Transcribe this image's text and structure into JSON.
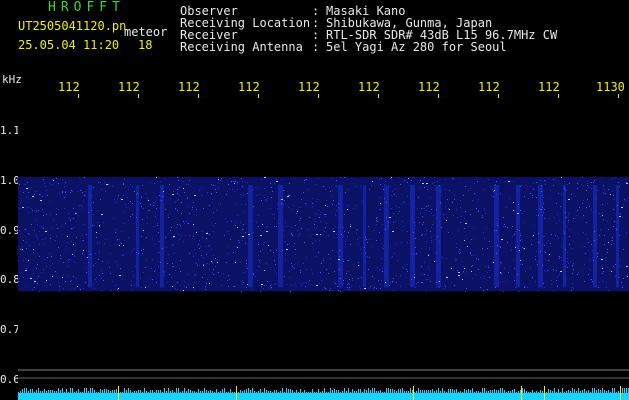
{
  "header": {
    "title": "HROFFT",
    "filename": "UT2505041120.pn",
    "filename_suffix": "meteor",
    "timestamp": "25.05.04 11:20",
    "count": "18"
  },
  "meta": [
    {
      "label": "Observer",
      "value": "Masaki Kano"
    },
    {
      "label": "Receiving Location",
      "value": "Shibukawa, Gunma, Japan"
    },
    {
      "label": "Receiver",
      "value": "RTL-SDR SDR# 43dB L15 96.7MHz CW"
    },
    {
      "label": "Receiving Antenna",
      "value": "5el Yagi Az 280 for Seoul"
    }
  ],
  "chart_data": {
    "type": "heatmap",
    "ylabel": "kHz",
    "x_ticks": [
      "112",
      "112",
      "112",
      "112",
      "112",
      "112",
      "112",
      "112",
      "112",
      "1130"
    ],
    "y_ticks": [
      "1.1",
      "1.0",
      "0.9",
      "0.8",
      "0.7",
      "0.6"
    ],
    "ylim": [
      0.58,
      1.15
    ],
    "band_khz": [
      0.79,
      1.0
    ],
    "colors": {
      "background": "#000000",
      "band": "#1a2fd0",
      "speckle": "#9fd8ff",
      "baseline": "#19d4ff",
      "bright": "#f0f000",
      "grid": "#808080"
    }
  }
}
